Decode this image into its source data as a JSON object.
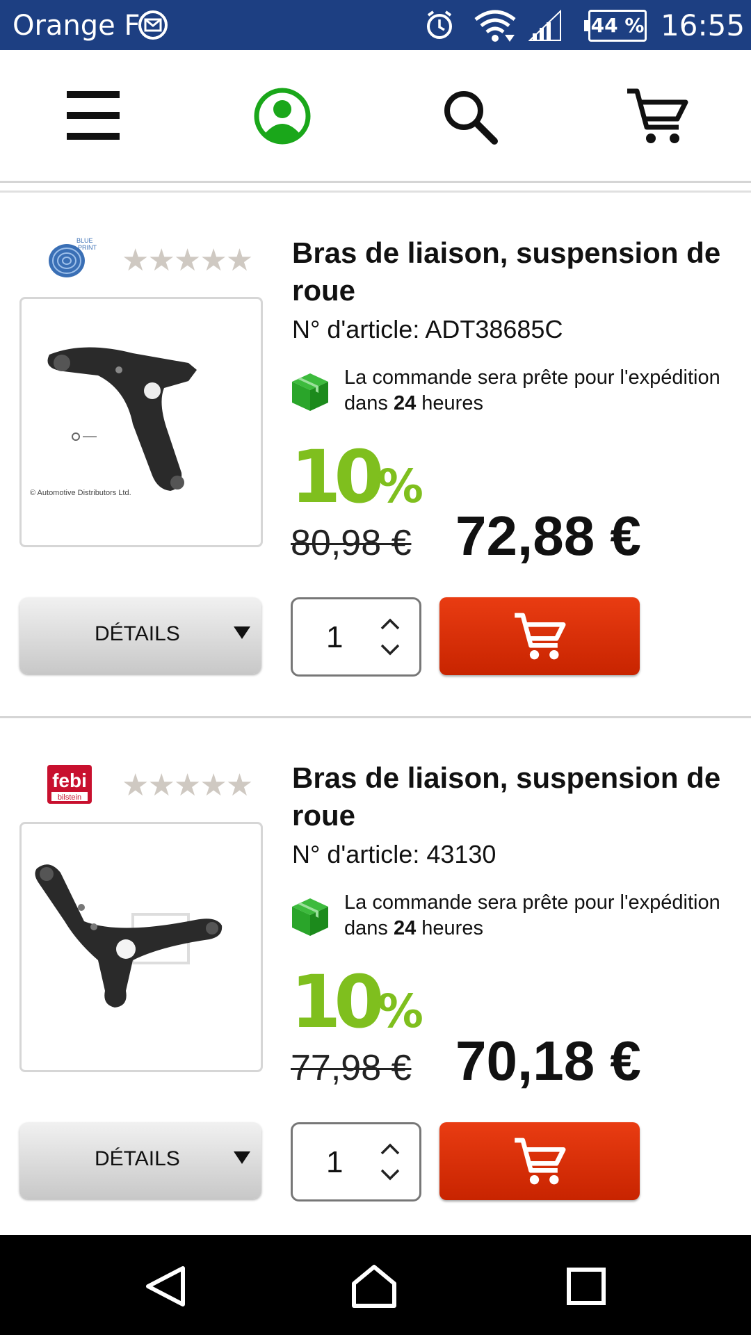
{
  "status_bar": {
    "carrier": "Orange F",
    "battery": "44 %",
    "time": "16:55"
  },
  "top_nav": {
    "icons": [
      "menu-icon",
      "user-account-icon",
      "search-icon",
      "cart-icon"
    ],
    "user_icon_color": "#1aa71a"
  },
  "products": [
    {
      "brand": "BLUE PRINT",
      "title": "Bras de liaison, suspension de roue",
      "article": "N° d'article: ADT38685C",
      "ship_text_prefix": "La commande sera prête pour l'expédition dans ",
      "ship_hours": "24",
      "ship_text_suffix": " heures",
      "discount": "10",
      "discount_pct": "%",
      "old_price": "80,98 €",
      "new_price": "72,88 €",
      "details_label": "DÉTAILS",
      "quantity": "1",
      "thumb_caption": "© Automotive Distributors Ltd."
    },
    {
      "brand": "febi bilstein",
      "brand_short": "febi",
      "brand_sub": "bilstein",
      "title": "Bras de liaison, suspension de roue",
      "article": "N° d'article: 43130",
      "ship_text_prefix": "La commande sera prête pour l'expédition dans ",
      "ship_hours": "24",
      "ship_text_suffix": " heures",
      "discount": "10",
      "discount_pct": "%",
      "old_price": "77,98 €",
      "new_price": "70,18 €",
      "details_label": "DÉTAILS",
      "quantity": "1"
    }
  ],
  "colors": {
    "status_bar": "#1d3f82",
    "add_to_cart": "#d63010",
    "discount": "#7fbf1e",
    "ship_icon": "#2aa52a"
  },
  "system_nav": [
    "back-icon",
    "home-icon",
    "recent-apps-icon"
  ]
}
